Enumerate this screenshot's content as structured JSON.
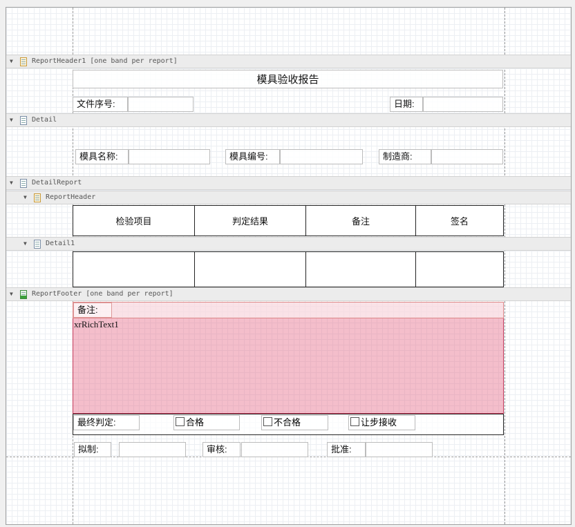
{
  "bands": {
    "report_header": "ReportHeader1 [one band per report]",
    "detail": "Detail",
    "detail_report": "DetailReport",
    "sub_report_header": "ReportHeader",
    "detail1": "Detail1",
    "report_footer": "ReportFooter [one band per report]"
  },
  "header": {
    "title": "模具验收报告",
    "doc_no_label": "文件序号:",
    "date_label": "日期:"
  },
  "detail": {
    "mold_name_label": "模具名称:",
    "mold_no_label": "模具编号:",
    "maker_label": "制造商:"
  },
  "table": {
    "columns": [
      "检验项目",
      "判定结果",
      "备注",
      "签名"
    ]
  },
  "footer": {
    "remark_label": "备注:",
    "richtext": "xrRichText1",
    "final_label": "最终判定:",
    "options": [
      "合格",
      "不合格",
      "让步接收"
    ],
    "draft_label": "拟制:",
    "review_label": "审核:",
    "approve_label": "批准:"
  }
}
